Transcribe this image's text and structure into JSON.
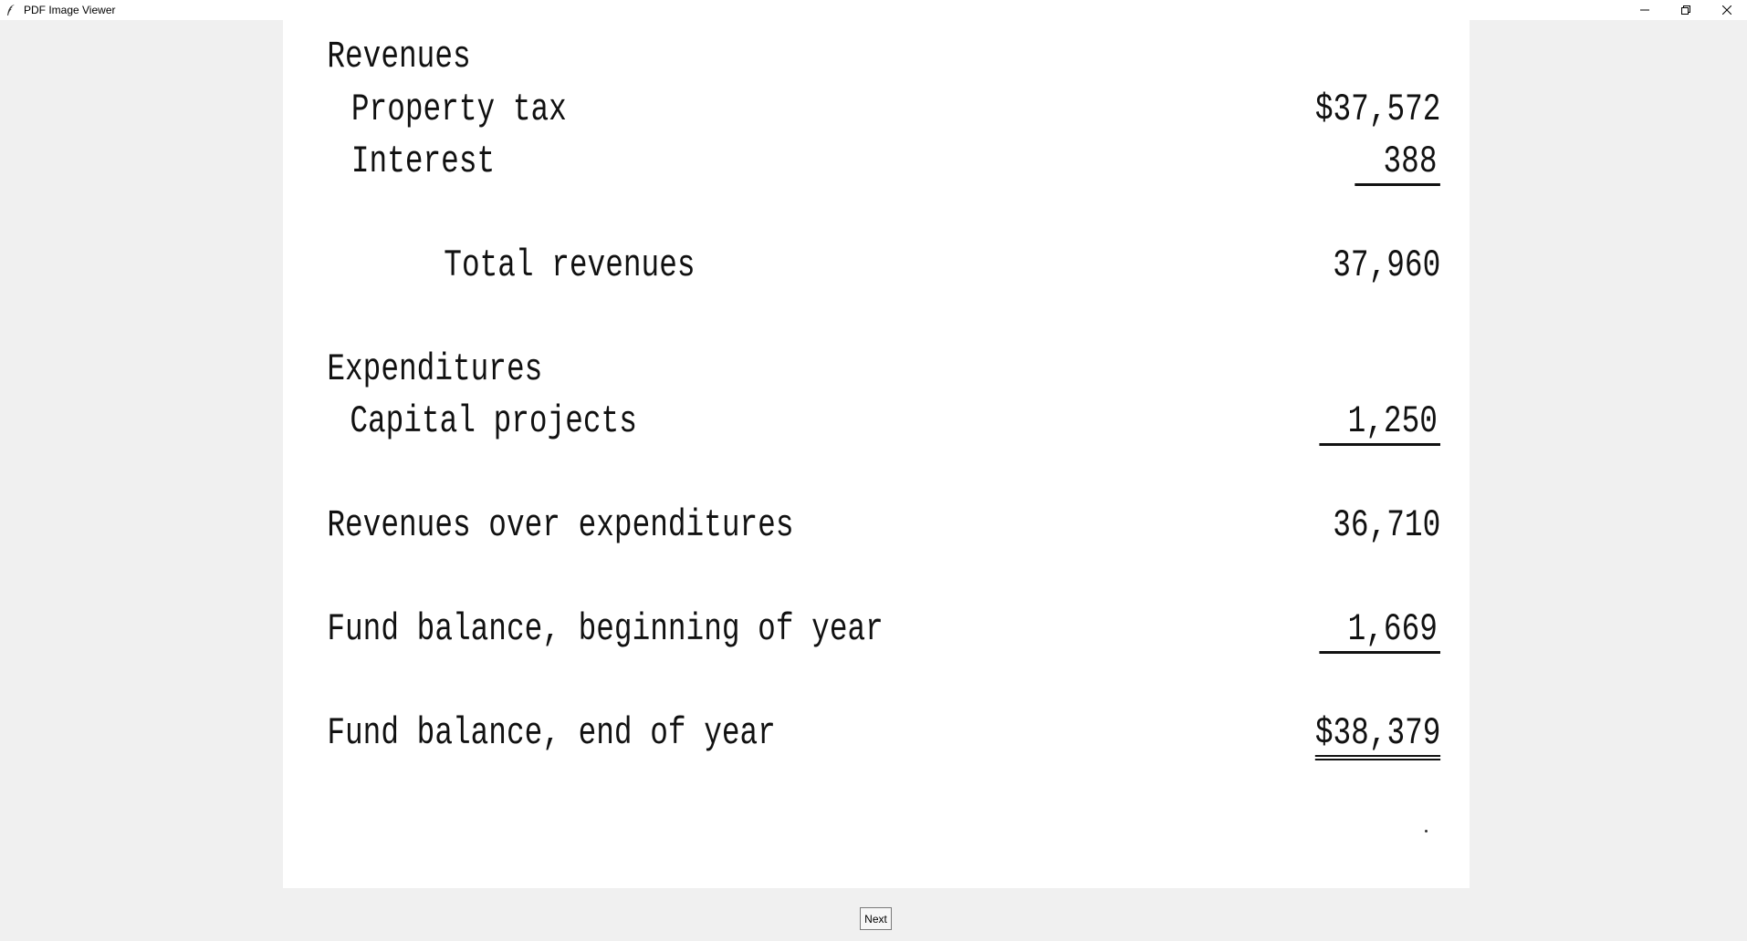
{
  "window": {
    "title": "PDF Image Viewer",
    "icon": "feather-icon",
    "controls": [
      "minimize-icon",
      "restore-icon",
      "close-icon"
    ]
  },
  "statement": {
    "revenues_heading": "Revenues",
    "property_tax_label": "Property tax",
    "property_tax_value": "$37,572",
    "interest_label": "Interest",
    "interest_value": "388",
    "total_revenues_label": "Total revenues",
    "total_revenues_value": "37,960",
    "expenditures_heading": "Expenditures",
    "capital_projects_label": "Capital projects",
    "capital_projects_value": "1,250",
    "rev_over_exp_label": "Revenues over expenditures",
    "rev_over_exp_value": "36,710",
    "fund_begin_label": "Fund balance, beginning of year",
    "fund_begin_value": "1,669",
    "fund_end_label": "Fund balance, end of year",
    "fund_end_value": "$38,379"
  },
  "navigation": {
    "next_label": "Next"
  }
}
